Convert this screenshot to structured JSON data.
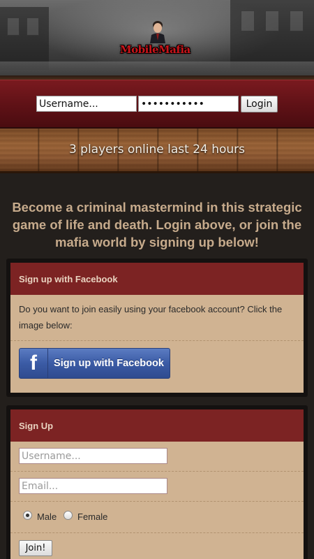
{
  "header": {
    "logo_text": "MobileMafia"
  },
  "login": {
    "username_value": "Username...",
    "password_value": "•••••••••••",
    "login_label": "Login"
  },
  "status": {
    "players_online": "3 players online last 24 hours"
  },
  "intro": {
    "tagline": "Become a criminal mastermind in this strategic game of life and death. Login above, or join the mafia world by signing up below!"
  },
  "facebook": {
    "title": "Sign up with Facebook",
    "description": "Do you want to join easily using your facebook account? Click the image below:",
    "button_icon": "f",
    "button_label": "Sign up with Facebook",
    "brand_color": "#3b5ba5"
  },
  "signup": {
    "title": "Sign Up",
    "username_placeholder": "Username...",
    "email_placeholder": "Email...",
    "gender_options": [
      {
        "label": "Male",
        "selected": true
      },
      {
        "label": "Female",
        "selected": false
      }
    ],
    "join_label": "Join!"
  },
  "colors": {
    "panel_header": "#7c2323",
    "panel_body": "#d0b392",
    "tagline": "#c7ab8c"
  }
}
